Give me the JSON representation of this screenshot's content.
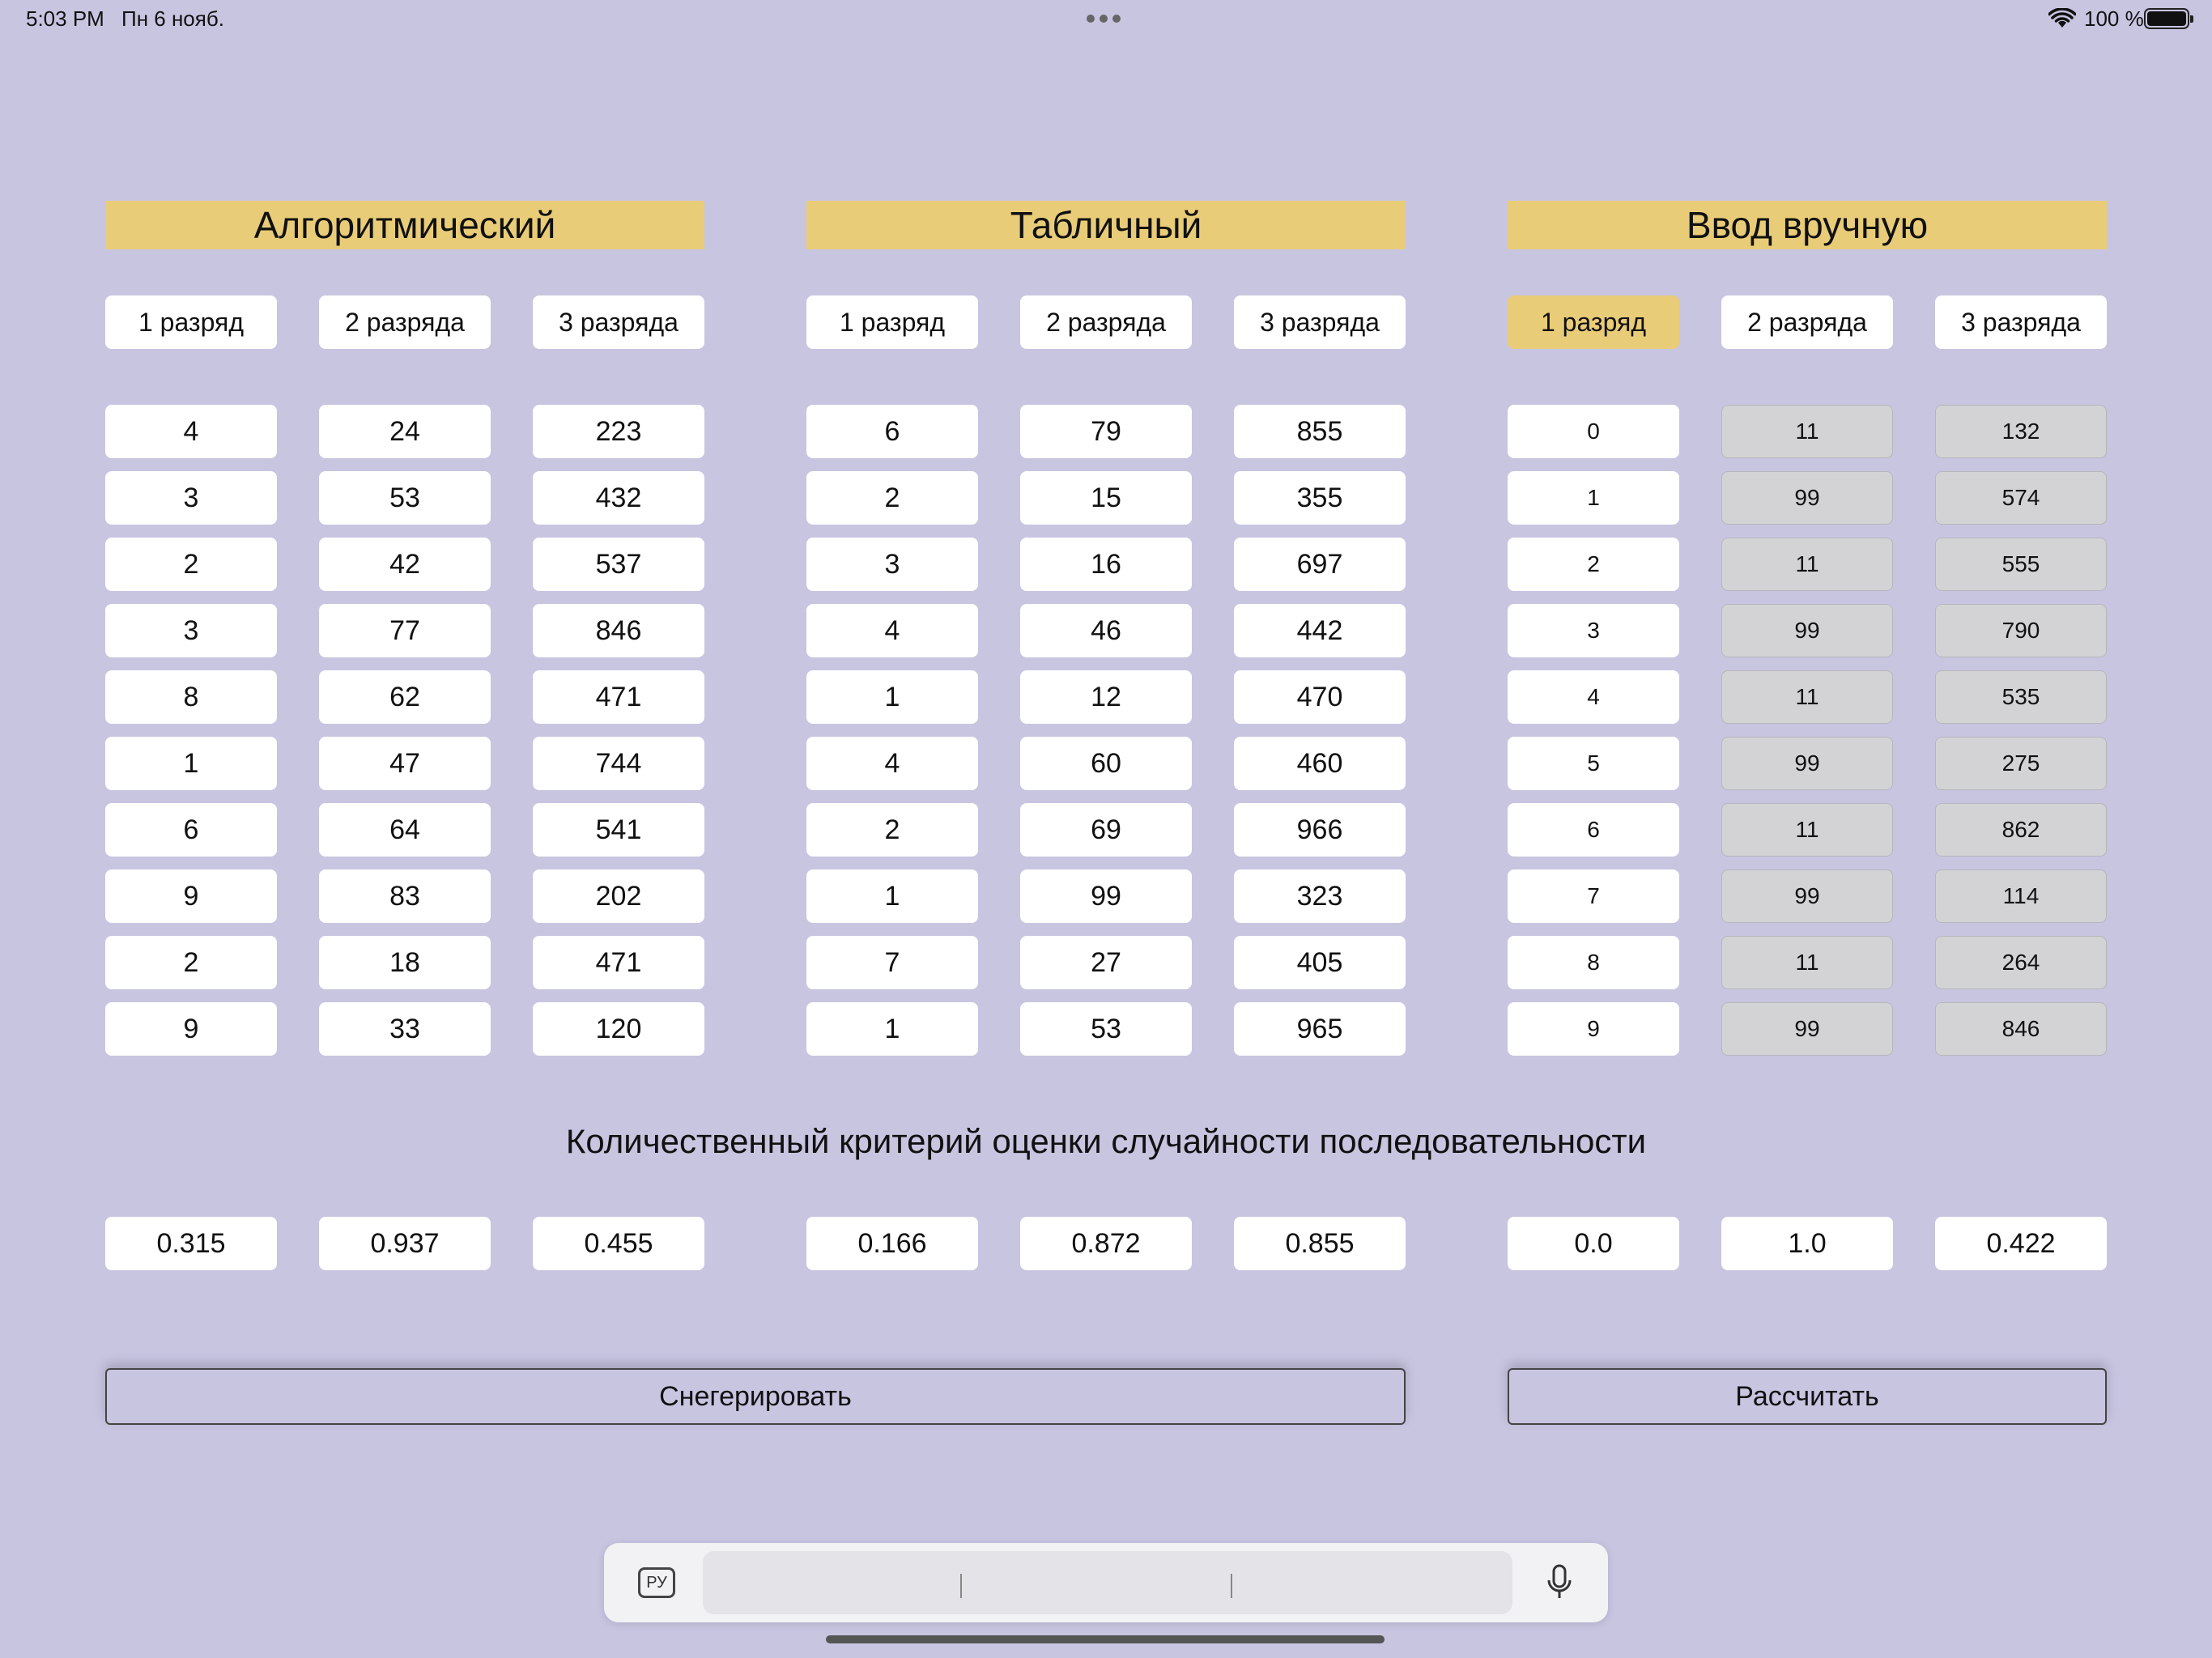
{
  "status_bar": {
    "time": "5:03 PM",
    "date": "Пн 6 нояб.",
    "battery": "100 %"
  },
  "colors": {
    "background": "#c8c5e1",
    "accent": "#e8cc78",
    "disabled": "#d3d3d6"
  },
  "sections": [
    {
      "title": "Алгоритмический",
      "tabs": [
        "1 разряд",
        "2 разряда",
        "3 разряда"
      ],
      "selected_tab": null,
      "columns": [
        [
          "4",
          "3",
          "2",
          "3",
          "8",
          "1",
          "6",
          "9",
          "2",
          "9"
        ],
        [
          "24",
          "53",
          "42",
          "77",
          "62",
          "47",
          "64",
          "83",
          "18",
          "33"
        ],
        [
          "223",
          "432",
          "537",
          "846",
          "471",
          "744",
          "541",
          "202",
          "471",
          "120"
        ]
      ],
      "criteria": [
        "0.315",
        "0.937",
        "0.455"
      ]
    },
    {
      "title": "Табличный",
      "tabs": [
        "1 разряд",
        "2 разряда",
        "3 разряда"
      ],
      "selected_tab": null,
      "columns": [
        [
          "6",
          "2",
          "3",
          "4",
          "1",
          "4",
          "2",
          "1",
          "7",
          "1"
        ],
        [
          "79",
          "15",
          "16",
          "46",
          "12",
          "60",
          "69",
          "99",
          "27",
          "53"
        ],
        [
          "855",
          "355",
          "697",
          "442",
          "470",
          "460",
          "966",
          "323",
          "405",
          "965"
        ]
      ],
      "criteria": [
        "0.166",
        "0.872",
        "0.855"
      ]
    },
    {
      "title": "Ввод вручную",
      "tabs": [
        "1 разряд",
        "2 разряда",
        "3 разряда"
      ],
      "selected_tab": 0,
      "columns": [
        [
          "0",
          "1",
          "2",
          "3",
          "4",
          "5",
          "6",
          "7",
          "8",
          "9"
        ],
        [
          "11",
          "99",
          "11",
          "99",
          "11",
          "99",
          "11",
          "99",
          "11",
          "99"
        ],
        [
          "132",
          "574",
          "555",
          "790",
          "535",
          "275",
          "862",
          "114",
          "264",
          "846"
        ]
      ],
      "criteria": [
        "0.0",
        "1.0",
        "0.422"
      ]
    }
  ],
  "criteria_title": "Количественный критерий оценки случайности последовательности",
  "buttons": {
    "generate": "Снегерировать",
    "calculate": "Рассчитать"
  },
  "keyboard": {
    "language": "РУ",
    "mic_icon": "microphone-icon"
  }
}
